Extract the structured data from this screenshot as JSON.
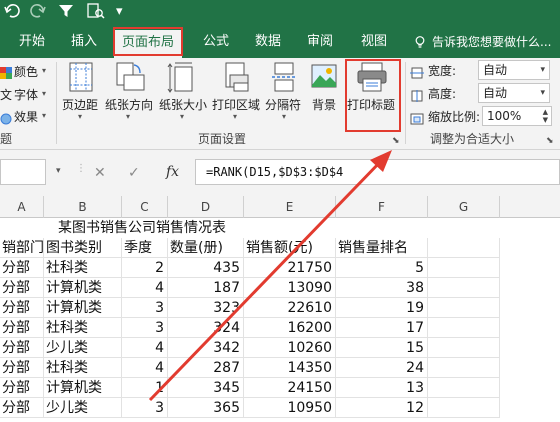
{
  "quick_access": {
    "undo_icon": "undo-icon",
    "redo_icon": "redo-icon",
    "filter_icon": "filter-icon",
    "print_preview_icon": "print-preview-icon",
    "more": "▾"
  },
  "tabs": [
    "开始",
    "插入",
    "页面布局",
    "公式",
    "数据",
    "审阅",
    "视图"
  ],
  "active_tab": "页面布局",
  "tell_me": "告诉我您想要做什么...",
  "ribbon": {
    "theme_group": {
      "colors": "颜色",
      "fonts": "字体",
      "effects": "效果",
      "label": "题"
    },
    "page_setup": {
      "buttons": [
        "页边距",
        "纸张方向",
        "纸张大小",
        "打印区域",
        "分隔符",
        "背景",
        "打印标题"
      ],
      "label": "页面设置"
    },
    "scale_to_fit": {
      "width_label": "宽度:",
      "width_value": "自动",
      "height_label": "高度:",
      "height_value": "自动",
      "scale_label": "缩放比例:",
      "scale_value": "100%",
      "label": "调整为合适大小"
    }
  },
  "formula_bar": {
    "cancel": "✕",
    "enter": "✓",
    "fx": "fx",
    "formula": "=RANK(D15,$D$3:$D$4"
  },
  "columns": [
    "A",
    "B",
    "C",
    "D",
    "E",
    "F",
    "G"
  ],
  "sheet": {
    "title": "某图书销售公司销售情况表",
    "headers": [
      "销部门",
      "图书类别",
      "季度",
      "数量(册)",
      "销售额(元)",
      "销售量排名"
    ],
    "rows": [
      [
        "分部",
        "社科类",
        "2",
        "435",
        "21750",
        "5"
      ],
      [
        "分部",
        "计算机类",
        "4",
        "187",
        "13090",
        "38"
      ],
      [
        "分部",
        "计算机类",
        "3",
        "323",
        "22610",
        "19"
      ],
      [
        "分部",
        "社科类",
        "3",
        "324",
        "16200",
        "17"
      ],
      [
        "分部",
        "少儿类",
        "4",
        "342",
        "10260",
        "15"
      ],
      [
        "分部",
        "社科类",
        "4",
        "287",
        "14350",
        "24"
      ],
      [
        "分部",
        "计算机类",
        "1",
        "345",
        "24150",
        "13"
      ],
      [
        "分部",
        "少儿类",
        "3",
        "365",
        "10950",
        "12"
      ]
    ]
  },
  "colors": {
    "excel_green": "#217346",
    "annotation_red": "#e23b2f",
    "ribbon_bg": "#f3f3f3"
  }
}
